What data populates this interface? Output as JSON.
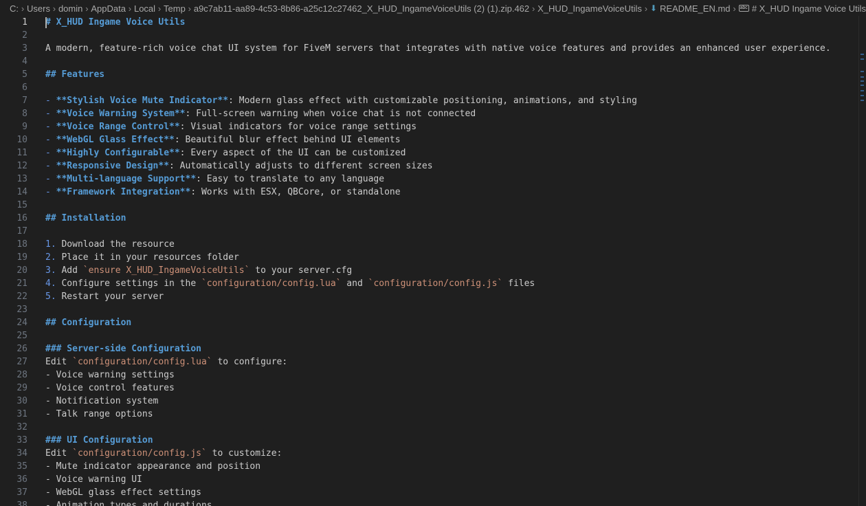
{
  "breadcrumb": [
    {
      "label": "C:"
    },
    {
      "label": "Users"
    },
    {
      "label": "domin"
    },
    {
      "label": "AppData"
    },
    {
      "label": "Local"
    },
    {
      "label": "Temp"
    },
    {
      "label": "a9c7ab11-aa89-4c53-8b86-a25c12c27462_X_HUD_IngameVoiceUtils (2) (1).zip.462"
    },
    {
      "label": "X_HUD_IngameVoiceUtils"
    },
    {
      "label": "README_EN.md",
      "icon": "markdown-file-icon"
    },
    {
      "label": "# X_HUD Ingame Voice Utils",
      "icon": "symbol-string-icon"
    }
  ],
  "editor": {
    "active_line": 1,
    "lines": [
      [
        {
          "t": "# X_HUD Ingame Voice Utils",
          "s": "h"
        }
      ],
      [],
      [
        {
          "t": "A modern, feature-rich voice chat UI system for FiveM servers that integrates with native voice features and provides an enhanced user experience."
        }
      ],
      [],
      [
        {
          "t": "## Features",
          "s": "h"
        }
      ],
      [],
      [
        {
          "t": "- ",
          "s": "bl"
        },
        {
          "t": "**Stylish Voice Mute Indicator**",
          "s": "b"
        },
        {
          "t": ": Modern glass effect with customizable positioning, animations, and styling"
        }
      ],
      [
        {
          "t": "- ",
          "s": "bl"
        },
        {
          "t": "**Voice Warning System**",
          "s": "b"
        },
        {
          "t": ": Full-screen warning when voice chat is not connected"
        }
      ],
      [
        {
          "t": "- ",
          "s": "bl"
        },
        {
          "t": "**Voice Range Control**",
          "s": "b"
        },
        {
          "t": ": Visual indicators for voice range settings"
        }
      ],
      [
        {
          "t": "- ",
          "s": "bl"
        },
        {
          "t": "**WebGL Glass Effect**",
          "s": "b"
        },
        {
          "t": ": Beautiful blur effect behind UI elements"
        }
      ],
      [
        {
          "t": "- ",
          "s": "bl"
        },
        {
          "t": "**Highly Configurable**",
          "s": "b"
        },
        {
          "t": ": Every aspect of the UI can be customized"
        }
      ],
      [
        {
          "t": "- ",
          "s": "bl"
        },
        {
          "t": "**Responsive Design**",
          "s": "b"
        },
        {
          "t": ": Automatically adjusts to different screen sizes"
        }
      ],
      [
        {
          "t": "- ",
          "s": "bl"
        },
        {
          "t": "**Multi-language Support**",
          "s": "b"
        },
        {
          "t": ": Easy to translate to any language"
        }
      ],
      [
        {
          "t": "- ",
          "s": "bl"
        },
        {
          "t": "**Framework Integration**",
          "s": "b"
        },
        {
          "t": ": Works with ESX, QBCore, or standalone"
        }
      ],
      [],
      [
        {
          "t": "## Installation",
          "s": "h"
        }
      ],
      [],
      [
        {
          "t": "1. ",
          "s": "bl"
        },
        {
          "t": "Download the resource"
        }
      ],
      [
        {
          "t": "2. ",
          "s": "bl"
        },
        {
          "t": "Place it in your resources folder"
        }
      ],
      [
        {
          "t": "3. ",
          "s": "bl"
        },
        {
          "t": "Add "
        },
        {
          "t": "`ensure X_HUD_IngameVoiceUtils`",
          "s": "c"
        },
        {
          "t": " to your server.cfg"
        }
      ],
      [
        {
          "t": "4. ",
          "s": "bl"
        },
        {
          "t": "Configure settings in the "
        },
        {
          "t": "`configuration/config.lua`",
          "s": "c"
        },
        {
          "t": " and "
        },
        {
          "t": "`configuration/config.js`",
          "s": "c"
        },
        {
          "t": " files"
        }
      ],
      [
        {
          "t": "5. ",
          "s": "bl"
        },
        {
          "t": "Restart your server"
        }
      ],
      [],
      [
        {
          "t": "## Configuration",
          "s": "h"
        }
      ],
      [],
      [
        {
          "t": "### Server-side Configuration",
          "s": "h"
        }
      ],
      [
        {
          "t": "Edit "
        },
        {
          "t": "`configuration/config.lua`",
          "s": "c"
        },
        {
          "t": " to configure:"
        }
      ],
      [
        {
          "t": "- Voice warning settings"
        }
      ],
      [
        {
          "t": "- Voice control features"
        }
      ],
      [
        {
          "t": "- Notification system"
        }
      ],
      [
        {
          "t": "- Talk range options"
        }
      ],
      [],
      [
        {
          "t": "### UI Configuration",
          "s": "h"
        }
      ],
      [
        {
          "t": "Edit "
        },
        {
          "t": "`configuration/config.js`",
          "s": "c"
        },
        {
          "t": " to customize:"
        }
      ],
      [
        {
          "t": "- Mute indicator appearance and position"
        }
      ],
      [
        {
          "t": "- Voice warning UI"
        }
      ],
      [
        {
          "t": "- WebGL glass effect settings"
        }
      ],
      [
        {
          "t": "- Animation types and durations"
        }
      ]
    ]
  }
}
